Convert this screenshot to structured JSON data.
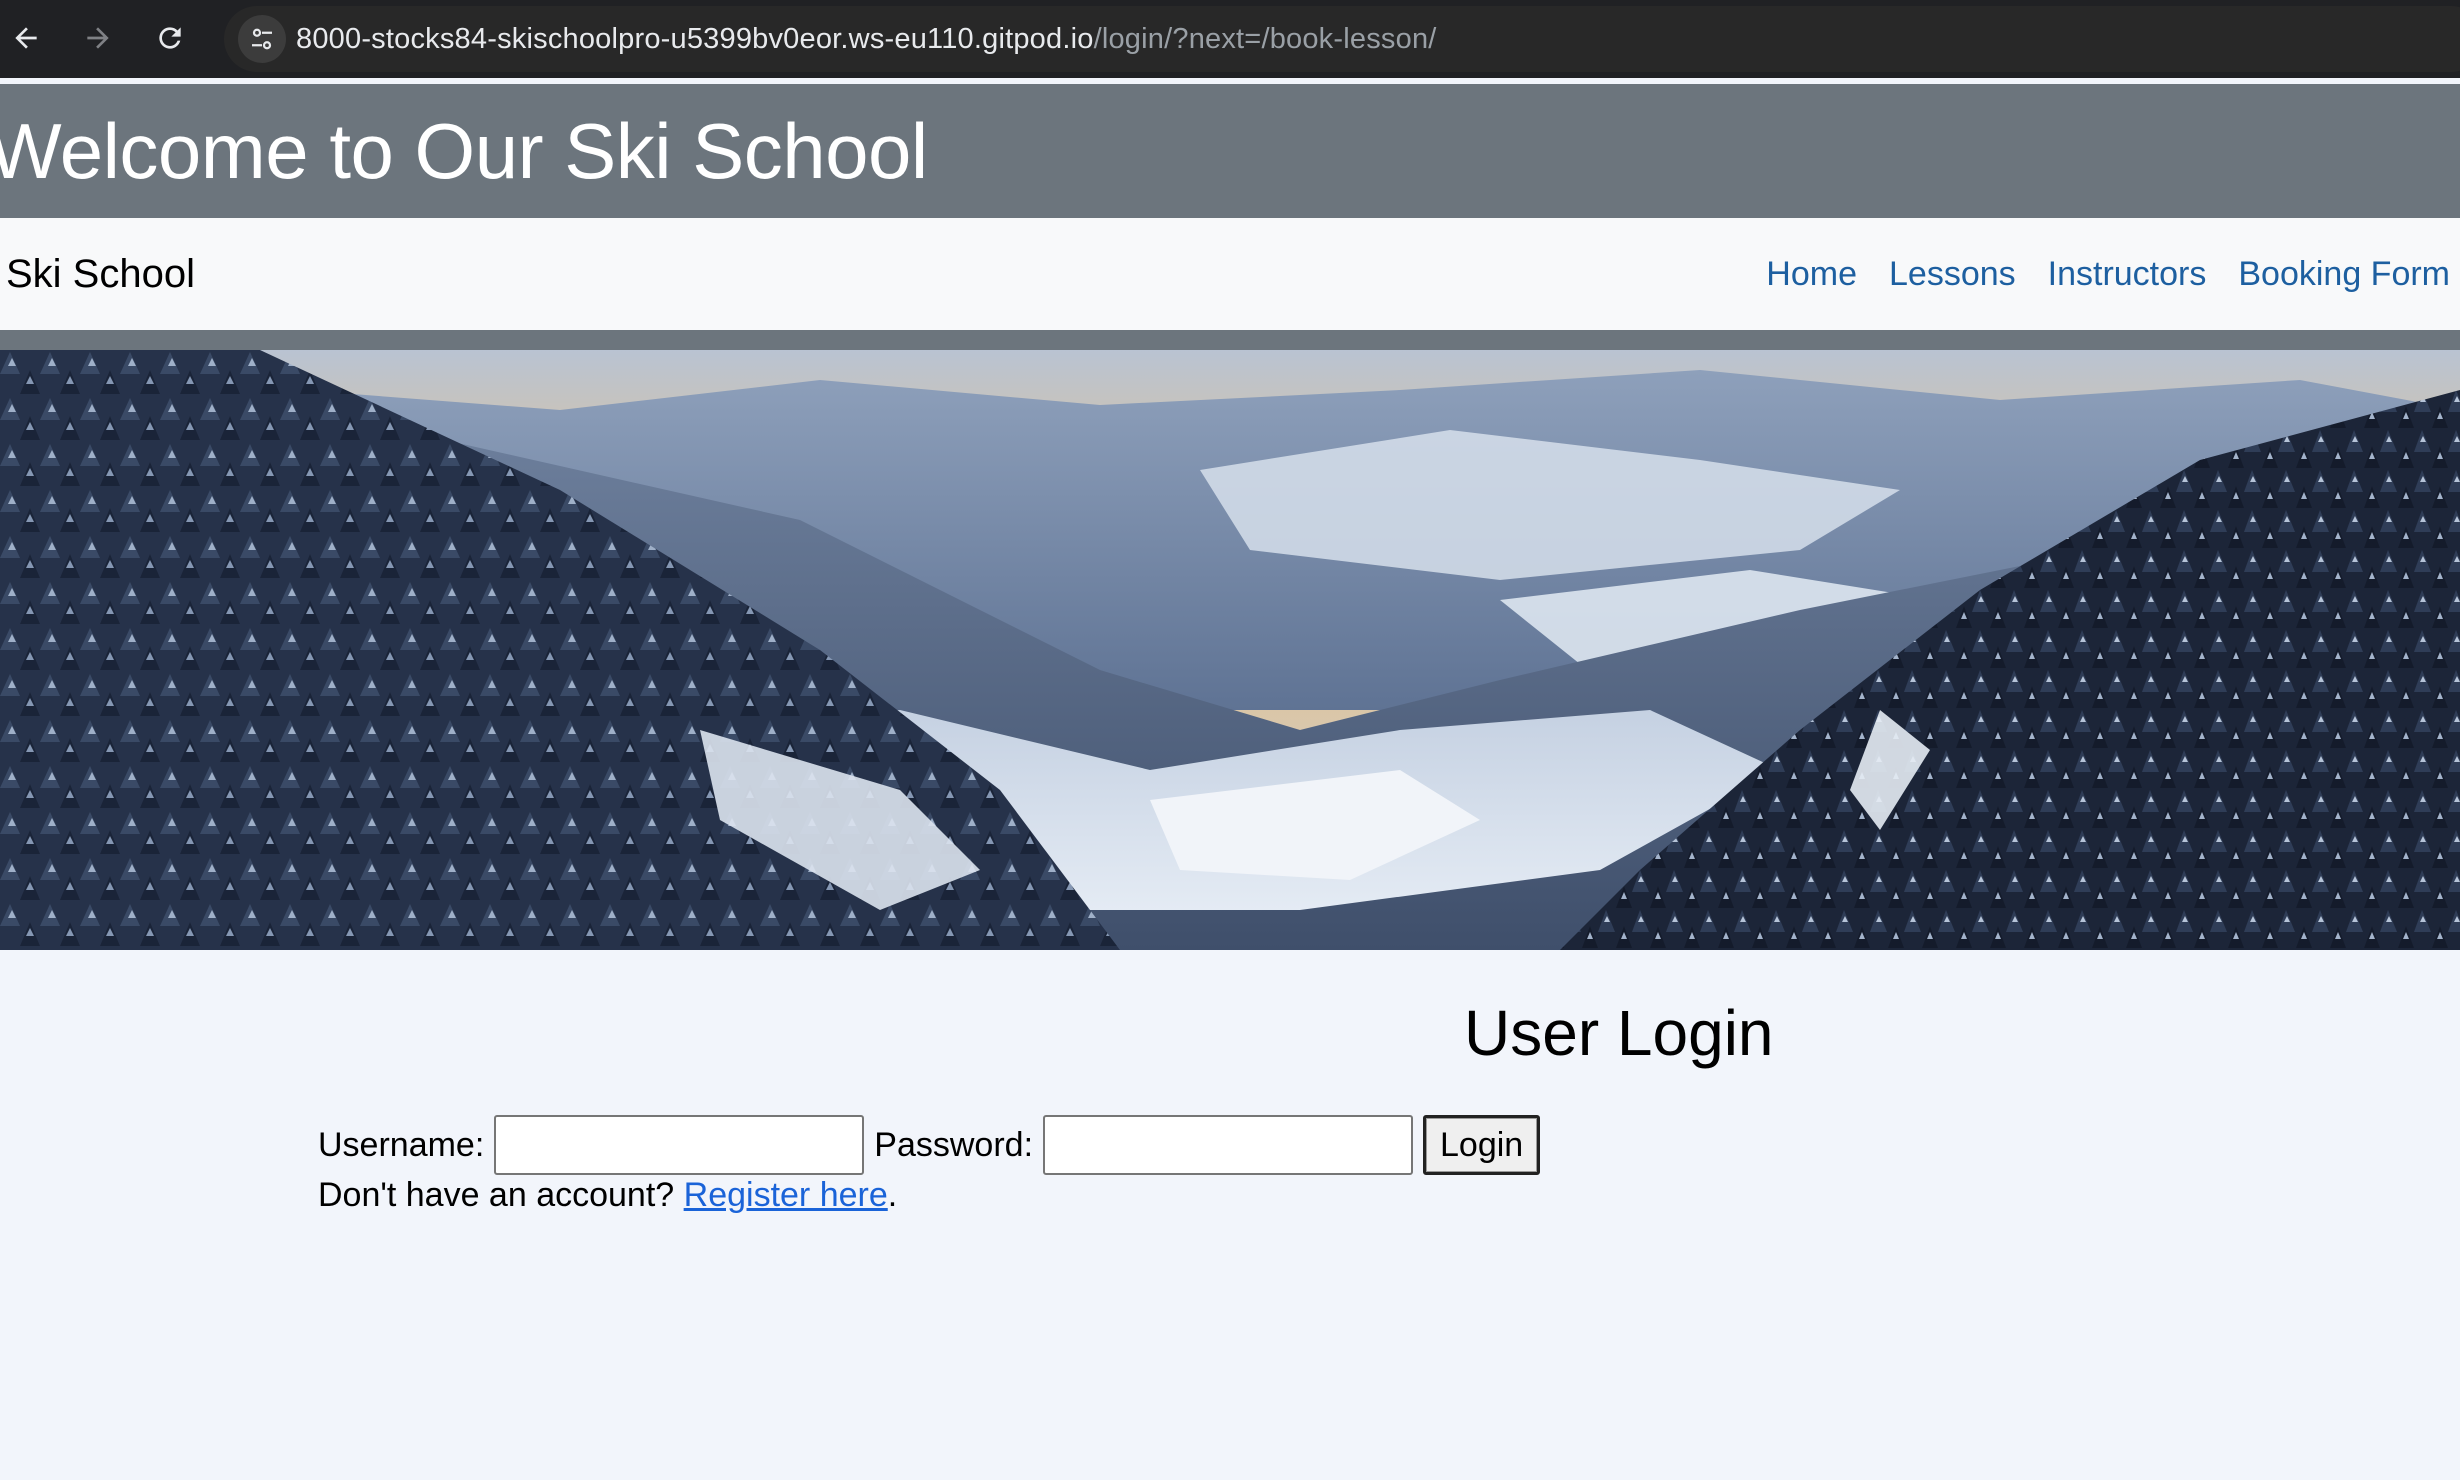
{
  "browser": {
    "url_host": "8000-stocks84-skischoolpro-u5399bv0eor.ws-eu110.gitpod.io",
    "url_path": "/login/?next=/book-lesson/",
    "back_icon": "arrow-left-icon",
    "forward_icon": "arrow-right-icon",
    "reload_icon": "reload-icon",
    "site_info_icon": "tune-icon"
  },
  "header": {
    "title": "Welcome to Our Ski School"
  },
  "navbar": {
    "brand": "Ski School",
    "links": [
      "Home",
      "Lessons",
      "Instructors",
      "Booking Form"
    ]
  },
  "hero": {
    "image": "snowy-mountain-valley-photo"
  },
  "login": {
    "title": "User Login",
    "username_label": "Username:",
    "username_value": "",
    "password_label": "Password:",
    "password_value": "",
    "submit_label": "Login",
    "register_prefix": "Don't have an account? ",
    "register_link": "Register here",
    "register_suffix": "."
  },
  "colors": {
    "header_bg": "#6c757d",
    "navbar_bg": "#f8f9fa",
    "nav_link": "#1d5fa0",
    "page_bg": "#f2f5fb",
    "link": "#1a63d8"
  }
}
